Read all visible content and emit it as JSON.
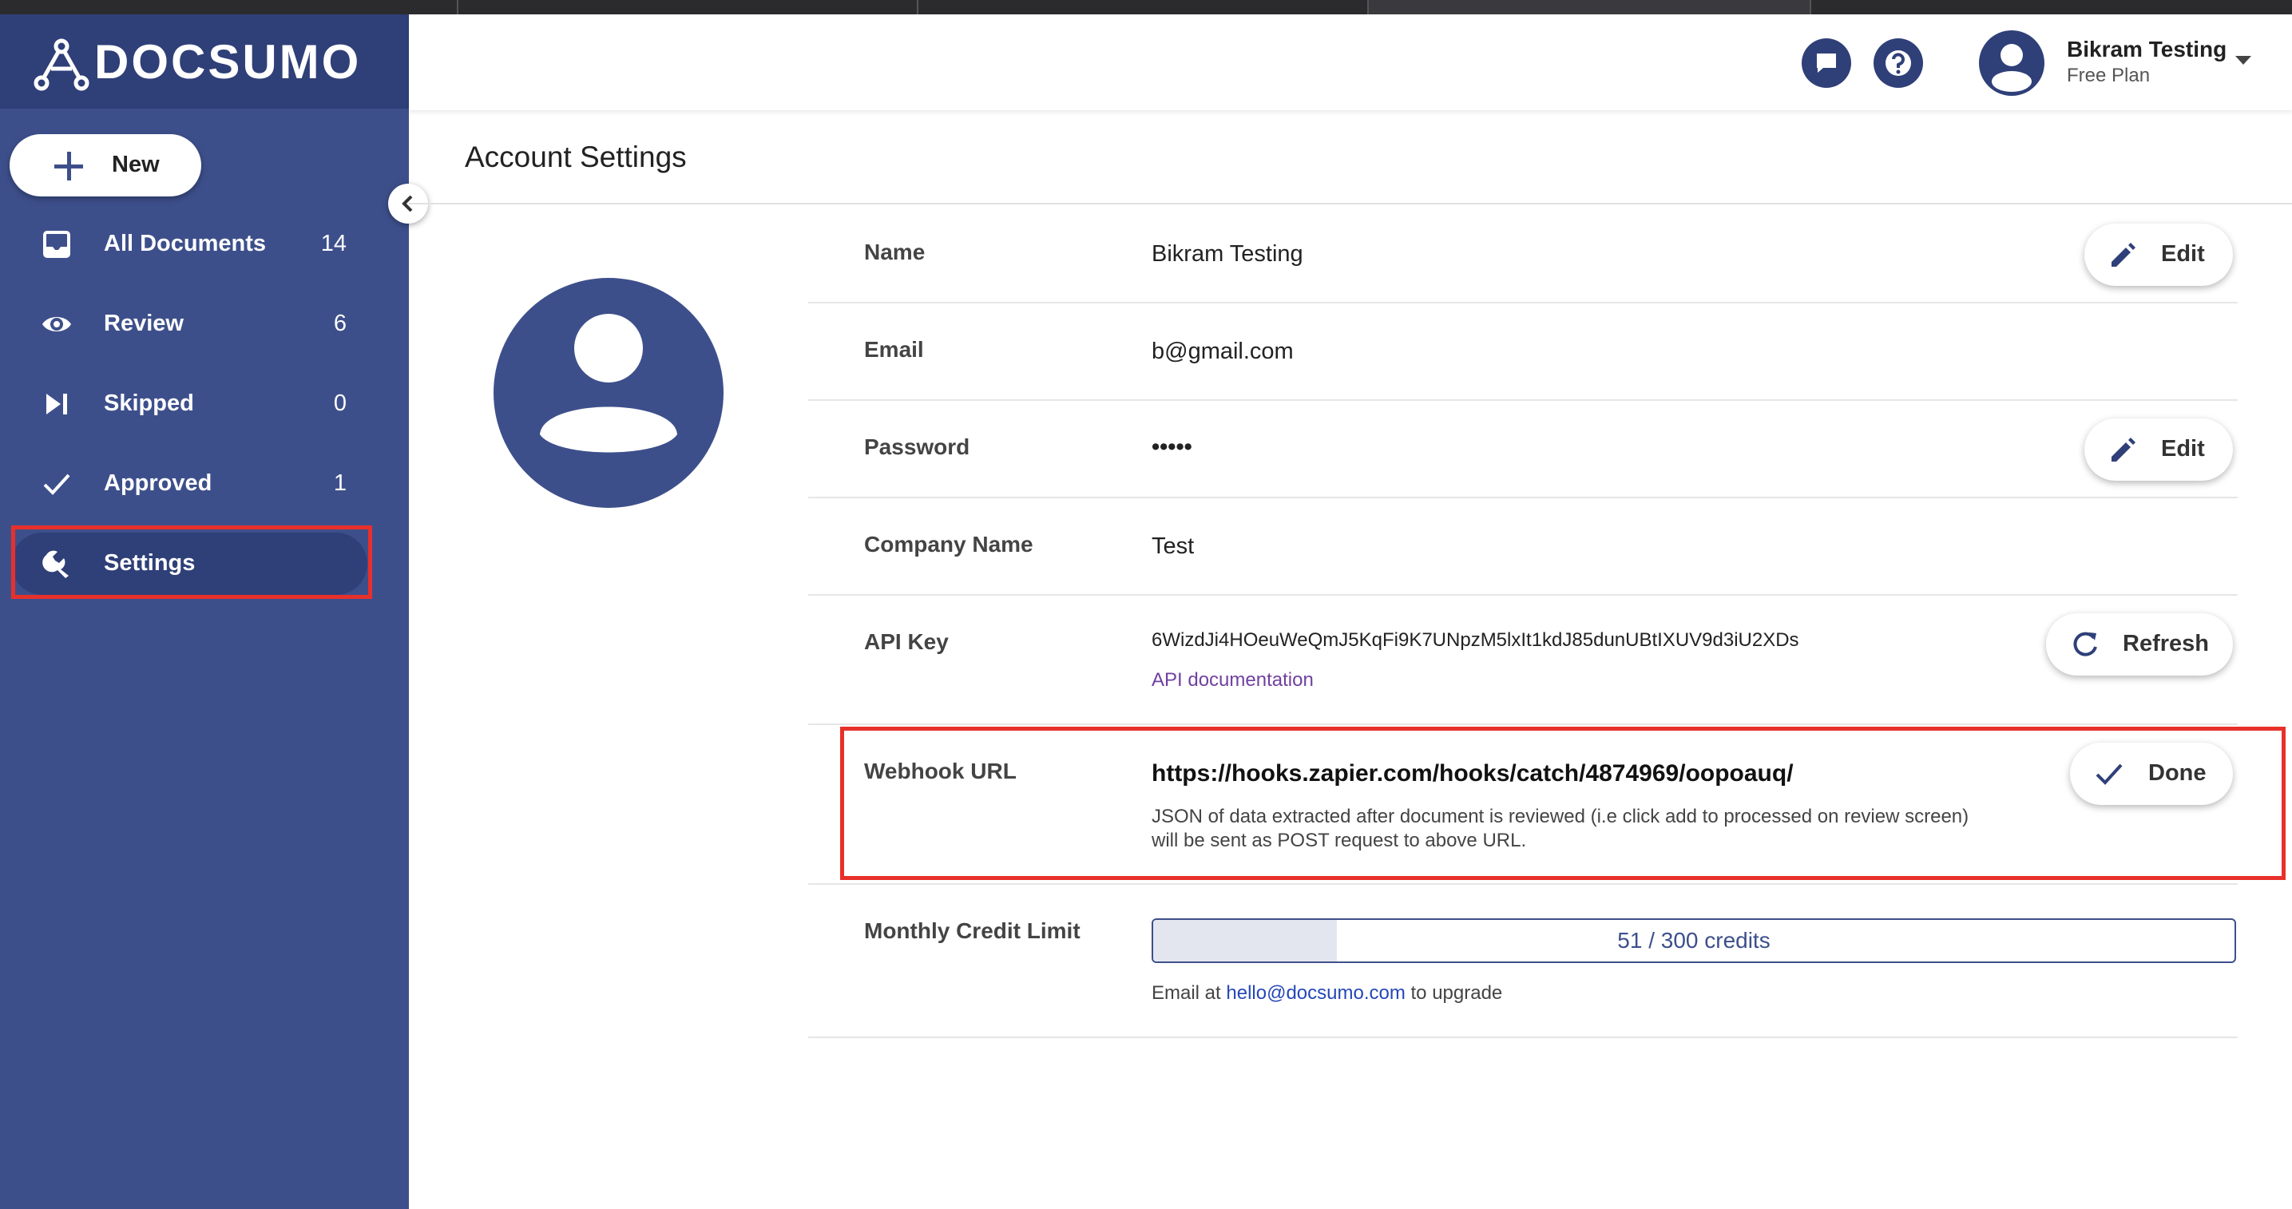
{
  "brand": {
    "name": "DOCSUMO"
  },
  "sidebar": {
    "new_label": "New",
    "items": [
      {
        "label": "All Documents",
        "count": "14",
        "icon": "inbox-icon"
      },
      {
        "label": "Review",
        "count": "6",
        "icon": "eye-icon"
      },
      {
        "label": "Skipped",
        "count": "0",
        "icon": "skip-icon"
      },
      {
        "label": "Approved",
        "count": "1",
        "icon": "check-icon"
      },
      {
        "label": "Settings",
        "count": "",
        "icon": "wrench-icon"
      }
    ]
  },
  "header": {
    "user_name": "Bikram Testing",
    "plan": "Free Plan",
    "icons": [
      "chat-icon",
      "help-icon",
      "avatar-icon",
      "caret-down-icon"
    ]
  },
  "page": {
    "title": "Account Settings"
  },
  "fields": {
    "name": {
      "label": "Name",
      "value": "Bikram Testing",
      "button": "Edit"
    },
    "email": {
      "label": "Email",
      "value": "b@gmail.com"
    },
    "password": {
      "label": "Password",
      "value": "•••••",
      "button": "Edit"
    },
    "company": {
      "label": "Company Name",
      "value": "Test"
    },
    "api_key": {
      "label": "API Key",
      "value": "6WizdJi4HOeuWeQmJ5KqFi9K7UNpzM5lxIt1kdJ85dunUBtIXUV9d3iU2XDs",
      "link": "API documentation",
      "button": "Refresh"
    },
    "webhook": {
      "label": "Webhook URL",
      "value": "https://hooks.zapier.com/hooks/catch/4874969/oopoauq/",
      "description": "JSON of data extracted after document is reviewed (i.e click add to processed on review screen) will be sent as POST request to above URL.",
      "button": "Done"
    },
    "credits": {
      "label": "Monthly Credit Limit",
      "used": 51,
      "total": 300,
      "text": "51 / 300 credits",
      "note_prefix": "Email at",
      "note_email": "hello@docsumo.com",
      "note_suffix": "to upgrade"
    }
  },
  "colors": {
    "sidebar": "#3d4f8b",
    "sidebar_dark": "#2f3f78",
    "highlight": "#e8302a",
    "link": "#2547b8"
  }
}
